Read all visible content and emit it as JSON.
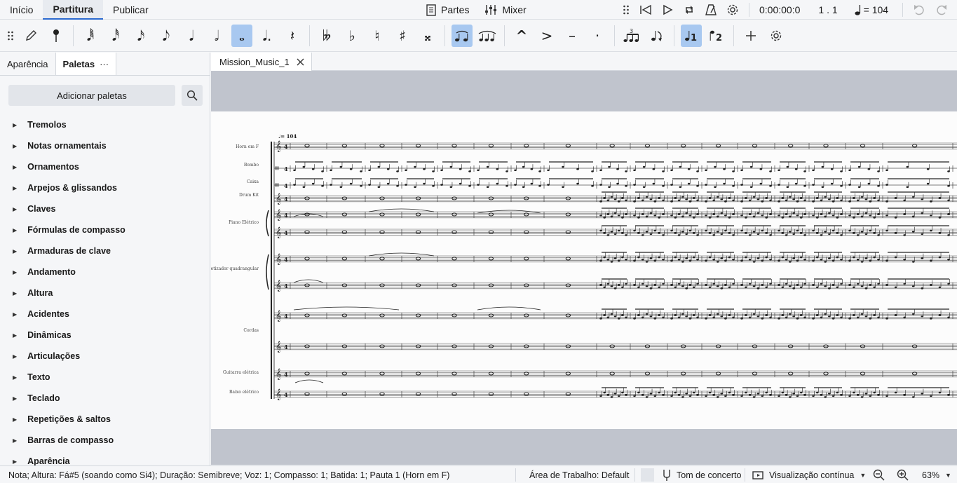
{
  "menu": {
    "tabs": [
      "Início",
      "Partitura",
      "Publicar"
    ],
    "active": "Partitura"
  },
  "top_center": {
    "parts_label": "Partes",
    "mixer_label": "Mixer"
  },
  "playback": {
    "time": "0:00:00:0",
    "position": "1 . 1",
    "tempo": "= 104"
  },
  "palette_panel": {
    "tabs": [
      "Aparência",
      "Paletas"
    ],
    "active": "Paletas",
    "more": "···",
    "add_button": "Adicionar paletas",
    "items": [
      "Tremolos",
      "Notas ornamentais",
      "Ornamentos",
      "Arpejos & glissandos",
      "Claves",
      "Fórmulas de compasso",
      "Armaduras de clave",
      "Andamento",
      "Altura",
      "Acidentes",
      "Dinâmicas",
      "Articulações",
      "Texto",
      "Teclado",
      "Repetições & saltos",
      "Barras de compasso",
      "Aparência"
    ]
  },
  "document": {
    "tab_title": "Mission_Music_1"
  },
  "score": {
    "tempo_mark": "♩= 104",
    "instruments": [
      "Horn em F",
      "Bombo",
      "Caixa",
      "Drum Kit",
      "Piano Elétrico",
      "Sintetizador quadrangular",
      "Cordas",
      "Guitarra elétrica",
      "Baixo elétrico"
    ]
  },
  "statusbar": {
    "note_info": "Nota; Altura: Fá#5 (soando como Si4); Duração: Semibreve; Voz: 1; Compasso: 1; Batida: 1; Pauta 1 (Horn em F)",
    "workspace": "Área de Trabalho: Default",
    "concert_pitch": "Tom de concerto",
    "view_mode": "Visualização contínua",
    "zoom": "63%"
  },
  "colors": {
    "accent": "#2b6ad0",
    "active_button": "#a8c8f0",
    "score_bg": "#c0c4cd",
    "paper": "#fcfcfc"
  }
}
